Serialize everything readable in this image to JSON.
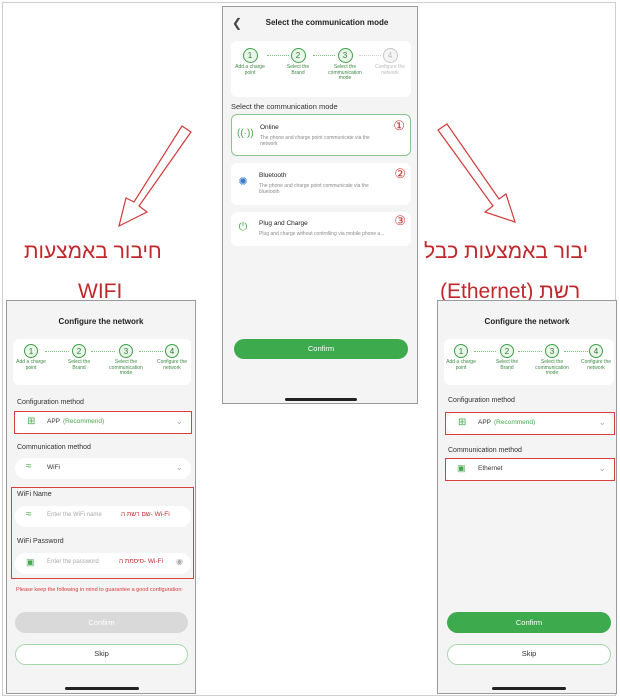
{
  "center": {
    "back_icon": "chevron-left-icon",
    "title": "Select the communication mode",
    "steps": [
      {
        "num": "1",
        "label": "Add a charge point",
        "active": true
      },
      {
        "num": "2",
        "label": "Select the Brand",
        "active": true
      },
      {
        "num": "3",
        "label": "Select the communication mode",
        "active": true
      },
      {
        "num": "4",
        "label": "Configure the network",
        "active": false
      }
    ],
    "section_title": "Select the communication mode",
    "options": [
      {
        "title": "Online",
        "desc": "The phone and charge point communicate via the network",
        "icon": "antenna-icon",
        "marker": "①"
      },
      {
        "title": "Bluetooth",
        "desc": "The phone and charge point communicate via the bluetooth",
        "icon": "bluetooth-icon",
        "marker": "②"
      },
      {
        "title": "Plug and Charge",
        "desc": "Plug and charge without controlling via mobile phone a...",
        "icon": "plug-icon",
        "marker": "③"
      }
    ],
    "confirm": "Confirm"
  },
  "left": {
    "title": "Configure the network",
    "steps": [
      {
        "num": "1",
        "label": "Add a charge point"
      },
      {
        "num": "2",
        "label": "Select the Brand"
      },
      {
        "num": "3",
        "label": "Select the communication mode"
      },
      {
        "num": "4",
        "label": "Configure the network"
      }
    ],
    "config_label": "Configuration method",
    "config_value": "APP",
    "config_recommend": "(Recommend)",
    "comm_label": "Communication method",
    "comm_value": "WiFi",
    "wifi_name_label": "WiFi Name",
    "wifi_name_placeholder": "Enter the WiFi name",
    "wifi_name_annot": "שם רשת ה- Wi-Fi",
    "wifi_pass_label": "WiFi Password",
    "wifi_pass_placeholder": "Enter the password",
    "wifi_pass_annot": "סיסמת ה- Wi-Fi",
    "warning": "Please keep the following in mind to guarantee a good configuration:",
    "confirm": "Confirm",
    "skip": "Skip"
  },
  "right": {
    "title": "Configure the network",
    "steps": [
      {
        "num": "1",
        "label": "Add a charge point"
      },
      {
        "num": "2",
        "label": "Select the Brand"
      },
      {
        "num": "3",
        "label": "Select the communication mode"
      },
      {
        "num": "4",
        "label": "Configure the network"
      }
    ],
    "config_label": "Configuration method",
    "config_value": "APP",
    "config_recommend": "(Recommend)",
    "comm_label": "Communication method",
    "comm_value": "Ethernet",
    "confirm": "Confirm",
    "skip": "Skip"
  },
  "annotations": {
    "left_line1": "חיבור באמצעות",
    "left_line2": "WIFI",
    "right_line1": "יבור באמצעות כבל",
    "right_line2": "רשת (Ethernet)"
  },
  "colors": {
    "accent": "#3eaa4e",
    "annotation_red": "#c0282c"
  }
}
